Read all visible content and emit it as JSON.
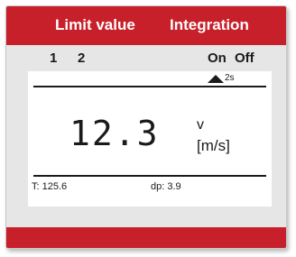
{
  "header": {
    "tabs": [
      {
        "label": "Limit value"
      },
      {
        "label": "Integration"
      }
    ]
  },
  "softkeys": {
    "key1": "1",
    "key2": "2",
    "on": "On",
    "off": "Off"
  },
  "display": {
    "timer": "2s",
    "timer_icon": "triangle-up-icon",
    "value": "12.3",
    "quantity": "v",
    "unit": "[m/s]",
    "temperature": "T: 125.6",
    "differential_pressure": "dp: 3.9"
  },
  "colors": {
    "accent": "#c8202a",
    "panel": "#e6e6e6",
    "screen": "#ffffff",
    "text": "#1a1a1a"
  }
}
